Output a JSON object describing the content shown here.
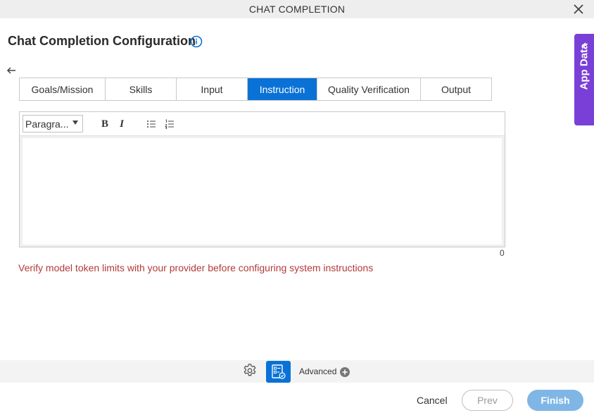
{
  "window": {
    "title": "CHAT COMPLETION"
  },
  "header": {
    "title": "Chat Completion Configuration"
  },
  "tabs": [
    {
      "label": "Goals/Mission",
      "active": false
    },
    {
      "label": "Skills",
      "active": false
    },
    {
      "label": "Input",
      "active": false
    },
    {
      "label": "Instruction",
      "active": true
    },
    {
      "label": "Quality Verification",
      "active": false
    },
    {
      "label": "Output",
      "active": false
    }
  ],
  "editor": {
    "format_select": "Paragra...",
    "bold_label": "B",
    "italic_label": "I",
    "content": "",
    "char_count": "0"
  },
  "warning": "Verify model token limits with your provider before configuring system instructions",
  "side_panel": {
    "label": "App Data"
  },
  "bottom_bar": {
    "advanced_label": "Advanced"
  },
  "footer": {
    "cancel_label": "Cancel",
    "prev_label": "Prev",
    "finish_label": "Finish"
  },
  "colors": {
    "accent": "#0a72d6",
    "side_panel": "#7a3fd6",
    "warning": "#b33a3a",
    "finish_disabled": "#7fb6e6"
  }
}
